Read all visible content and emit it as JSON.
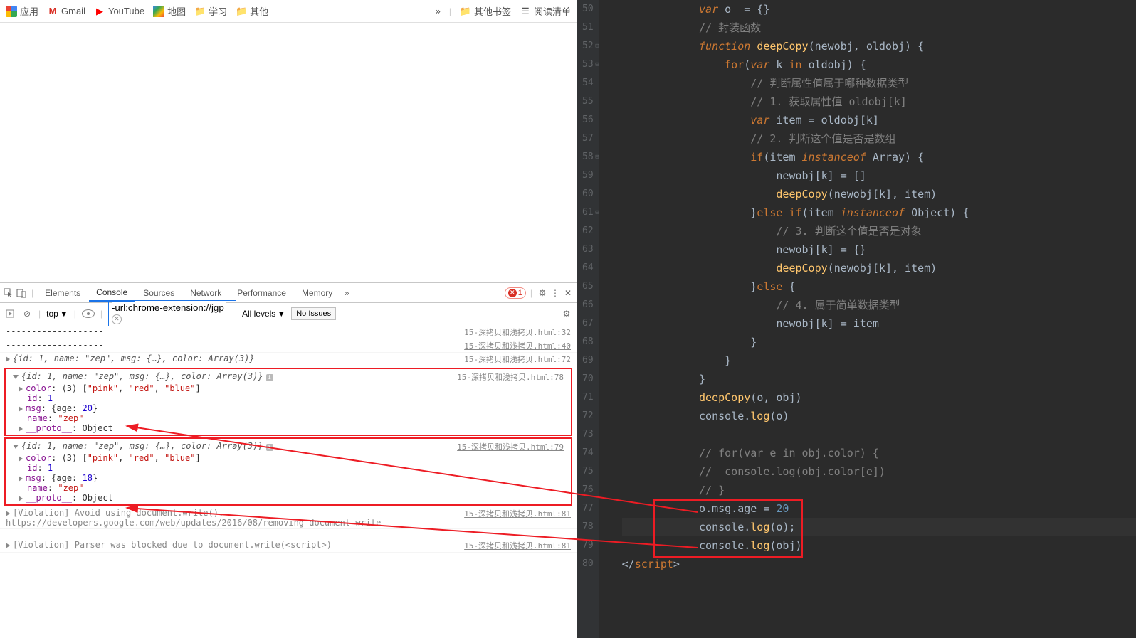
{
  "bookmarks": {
    "apps": "应用",
    "gmail": "Gmail",
    "youtube": "YouTube",
    "maps": "地图",
    "study": "学习",
    "other": "其他",
    "more": "»",
    "other_bookmarks": "其他书签",
    "reading_list": "阅读清单"
  },
  "devtools": {
    "tabs": {
      "elements": "Elements",
      "console": "Console",
      "sources": "Sources",
      "network": "Network",
      "performance": "Performance",
      "memory": "Memory"
    },
    "errors": "1",
    "filter_bar": {
      "context": "top",
      "filter": "-url:chrome-extension://jgp",
      "levels": "All levels",
      "issues": "No Issues"
    },
    "console": {
      "dashes1": "-------------------",
      "dashes2": "-------------------",
      "src32": "15-深拷贝和浅拷贝.html:32",
      "src40": "15-深拷贝和浅拷贝.html:40",
      "src72": "15-深拷贝和浅拷贝.html:72",
      "src78": "15-深拷贝和浅拷贝.html:78",
      "src79": "15-深拷贝和浅拷贝.html:79",
      "src81a": "15-深拷贝和浅拷贝.html:81",
      "src81b": "15-深拷贝和浅拷贝.html:81",
      "obj_summary": "{id: 1, name: \"zep\", msg: {…}, color: Array(3)}",
      "box1": {
        "summary": "{id: 1, name: \"zep\", msg: {…}, color: Array(3)}",
        "color": "color: (3) [\"pink\", \"red\", \"blue\"]",
        "id": "id: 1",
        "msg": "msg: {age: 20}",
        "name": "name: \"zep\"",
        "proto": "__proto__: Object"
      },
      "box2": {
        "summary": "{id: 1, name: \"zep\", msg: {…}, color: Array(3)}",
        "color": "color: (3) [\"pink\", \"red\", \"blue\"]",
        "id": "id: 1",
        "msg": "msg: {age: 18}",
        "name": "name: \"zep\"",
        "proto": "__proto__: Object"
      },
      "violation1_text": "[Violation] Avoid using document.write(). ",
      "violation1_link": "https://developers.google.com/web/updates/2016/08/removing-document-write",
      "violation2_text": "[Violation] Parser was blocked due to document.write(<script>)"
    }
  },
  "code": {
    "lines": [
      {
        "n": 50,
        "html": "<span class='kw'>var</span> <span class='var'>o</span>  <span class='op'>=</span> <span class='paren'>{}</span>"
      },
      {
        "n": 51,
        "html": "<span class='cmt'>// 封装函数</span>"
      },
      {
        "n": 52,
        "html": "<span class='kw'>function</span> <span class='fn'>deepCopy</span><span class='paren'>(</span><span class='var'>newobj</span><span class='op'>,</span> <span class='var'>oldobj</span><span class='paren'>)</span> <span class='paren'>{</span>",
        "fold": true
      },
      {
        "n": 53,
        "html": "    <span class='kw2'>for</span><span class='paren'>(</span><span class='kw'>var</span> <span class='var'>k</span> <span class='kw2'>in</span> <span class='var'>oldobj</span><span class='paren'>)</span> <span class='paren'>{</span>",
        "fold": true
      },
      {
        "n": 54,
        "html": "        <span class='cmt'>// 判断属性值属于哪种数据类型</span>"
      },
      {
        "n": 55,
        "html": "        <span class='cmt'>// 1. 获取属性值 oldobj[k]</span>"
      },
      {
        "n": 56,
        "html": "        <span class='kw'>var</span> <span class='var'>item</span> <span class='op'>=</span> <span class='var'>oldobj</span><span class='paren'>[</span><span class='var'>k</span><span class='paren'>]</span>"
      },
      {
        "n": 57,
        "html": "        <span class='cmt'>// 2. 判断这个值是否是数组</span>"
      },
      {
        "n": 58,
        "html": "        <span class='kw2'>if</span><span class='paren'>(</span><span class='var'>item</span> <span class='kw'>instanceof</span> <span class='var'>Array</span><span class='paren'>)</span> <span class='paren'>{</span>",
        "fold": true
      },
      {
        "n": 59,
        "html": "            <span class='var'>newobj</span><span class='paren'>[</span><span class='var'>k</span><span class='paren'>]</span> <span class='op'>=</span> <span class='paren'>[]</span>"
      },
      {
        "n": 60,
        "html": "            <span class='fn'>deepCopy</span><span class='paren'>(</span><span class='var'>newobj</span><span class='paren'>[</span><span class='var'>k</span><span class='paren'>]</span><span class='op'>,</span> <span class='var'>item</span><span class='paren'>)</span>"
      },
      {
        "n": 61,
        "html": "        <span class='paren'>}</span><span class='kw2'>else</span> <span class='kw2'>if</span><span class='paren'>(</span><span class='var'>item</span> <span class='kw'>instanceof</span> <span class='var'>Object</span><span class='paren'>)</span> <span class='paren'>{</span>",
        "fold": true
      },
      {
        "n": 62,
        "html": "            <span class='cmt'>// 3. 判断这个值是否是对象</span>"
      },
      {
        "n": 63,
        "html": "            <span class='var'>newobj</span><span class='paren'>[</span><span class='var'>k</span><span class='paren'>]</span> <span class='op'>=</span> <span class='paren'>{}</span>"
      },
      {
        "n": 64,
        "html": "            <span class='fn'>deepCopy</span><span class='paren'>(</span><span class='var'>newobj</span><span class='paren'>[</span><span class='var'>k</span><span class='paren'>]</span><span class='op'>,</span> <span class='var'>item</span><span class='paren'>)</span>"
      },
      {
        "n": 65,
        "html": "        <span class='paren'>}</span><span class='kw2'>else</span> <span class='paren'>{</span>"
      },
      {
        "n": 66,
        "html": "            <span class='cmt'>// 4. 属于简单数据类型</span>"
      },
      {
        "n": 67,
        "html": "            <span class='var'>newobj</span><span class='paren'>[</span><span class='var'>k</span><span class='paren'>]</span> <span class='op'>=</span> <span class='var'>item</span>"
      },
      {
        "n": 68,
        "html": "        <span class='paren'>}</span>"
      },
      {
        "n": 69,
        "html": "    <span class='paren'>}</span>"
      },
      {
        "n": 70,
        "html": "<span class='paren'>}</span>"
      },
      {
        "n": 71,
        "html": "<span class='fn'>deepCopy</span><span class='paren'>(</span><span class='var'>o</span><span class='op'>,</span> <span class='var'>obj</span><span class='paren'>)</span>"
      },
      {
        "n": 72,
        "html": "<span class='var'>console</span><span class='op'>.</span><span class='fn'>log</span><span class='paren'>(</span><span class='var'>o</span><span class='paren'>)</span>"
      },
      {
        "n": 73,
        "html": ""
      },
      {
        "n": 74,
        "html": "<span class='cmt'>// for(var e in obj.color) {</span>"
      },
      {
        "n": 75,
        "html": "<span class='cmt'>//  console.log(obj.color[e])</span>"
      },
      {
        "n": 76,
        "html": "<span class='cmt'>// }</span>"
      },
      {
        "n": 77,
        "html": "<span class='var'>o</span><span class='op'>.</span><span class='var'>msg</span><span class='op'>.</span><span class='var'>age</span> <span class='op'>=</span> <span class='num'>20</span>"
      },
      {
        "n": 78,
        "html": "<span class='var'>console</span><span class='op'>.</span><span class='fn'>log</span><span class='paren'>(</span><span class='var'>o</span><span class='paren'>);</span>",
        "highlight": true
      },
      {
        "n": 79,
        "html": "<span class='var'>console</span><span class='op'>.</span><span class='fn'>log</span><span class='paren'>(</span><span class='var'>obj</span><span class='paren'>)</span>"
      },
      {
        "n": 80,
        "html": "<span class='op'>&lt;/</span><span class='kw2'>script</span><span class='op'>&gt;</span>",
        "dedent": true
      }
    ]
  }
}
